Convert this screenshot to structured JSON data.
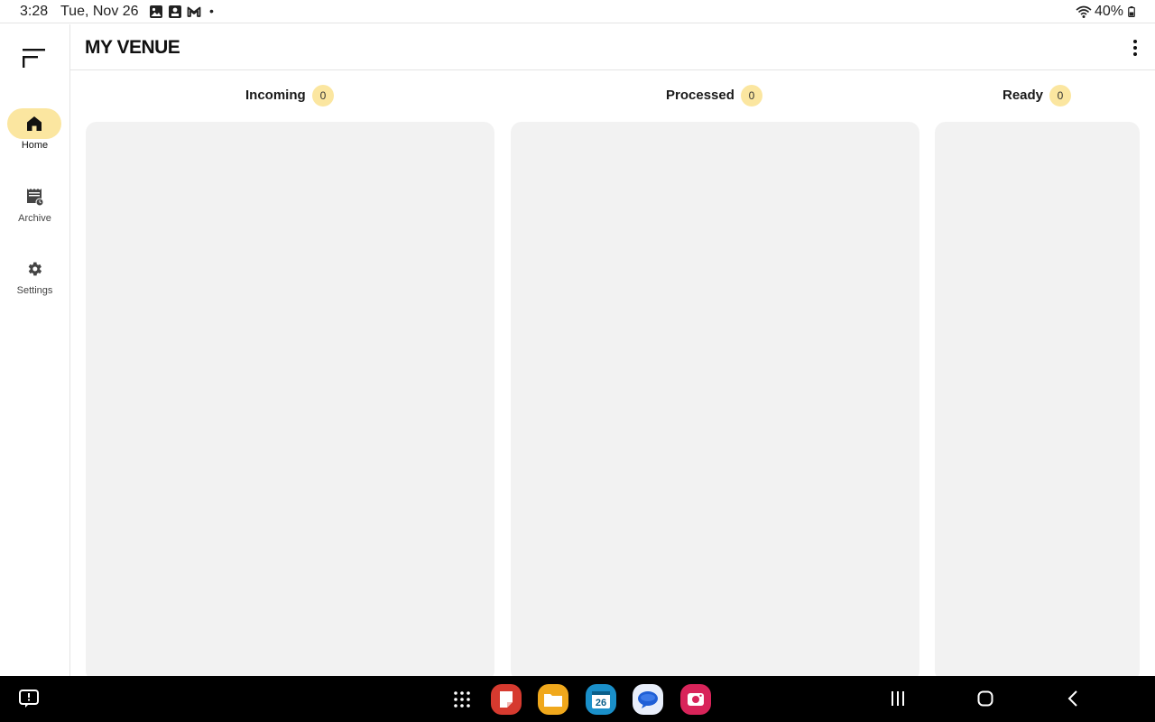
{
  "status_bar": {
    "time": "3:28",
    "date": "Tue, Nov 26",
    "notification_icons": [
      "gallery-icon",
      "screen-recorder-icon",
      "gmail-icon"
    ],
    "more_dot": "•",
    "battery": "40%"
  },
  "nav_rail": {
    "items": [
      {
        "label": "Home",
        "icon": "home-icon",
        "active": true
      },
      {
        "label": "Archive",
        "icon": "archive-receipt-icon",
        "active": false
      },
      {
        "label": "Settings",
        "icon": "gear-icon",
        "active": false
      }
    ]
  },
  "header": {
    "title": "MY VENUE"
  },
  "columns": [
    {
      "label": "Incoming",
      "count": "0"
    },
    {
      "label": "Processed",
      "count": "0"
    },
    {
      "label": "Ready",
      "count": "0"
    }
  ],
  "colors": {
    "accent": "#fbe6a0",
    "panel": "#f2f2f2"
  },
  "taskbar": {
    "apps": [
      "notes-app-icon",
      "my-files-app-icon",
      "calendar-app-icon",
      "messages-app-icon",
      "screen-recorder-app-icon"
    ],
    "calendar_day": "26"
  }
}
